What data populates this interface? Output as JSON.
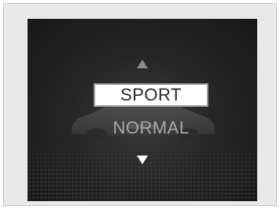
{
  "drive_mode_menu": {
    "modes": [
      "SPORT",
      "NORMAL"
    ],
    "selected_index": 0,
    "up_icon": "triangle-up-icon",
    "down_icon": "triangle-down-icon"
  },
  "colors": {
    "screen_bg": "#262626",
    "highlight_bg": "#ffffff",
    "inactive_text": "#a9a9a9",
    "up_arrow": "#8a8a8a",
    "down_arrow": "#ffffff"
  }
}
